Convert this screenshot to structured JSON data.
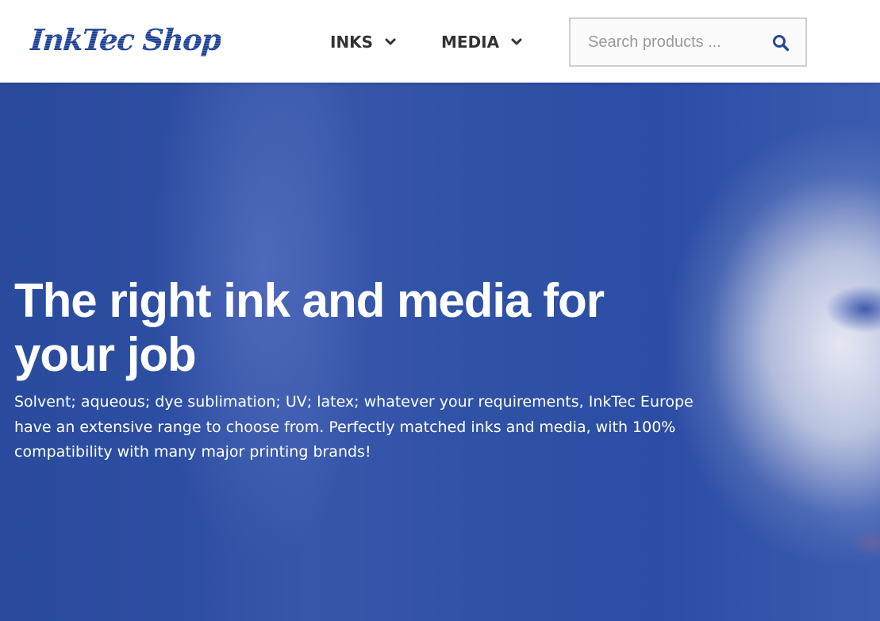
{
  "header": {
    "logo_text": "InkTec Shop",
    "nav": [
      {
        "label": "INKS"
      },
      {
        "label": "MEDIA"
      }
    ],
    "search": {
      "placeholder": "Search products ..."
    }
  },
  "hero": {
    "title": "The right ink and media for your job",
    "text": "Solvent; aqueous; dye sublimation; UV; latex; whatever your requirements, InkTec Europe have an extensive range to choose from. Perfectly matched inks and media, with 100% compatibility with many major printing brands!"
  },
  "colors": {
    "brand_blue": "#23489a",
    "hero_blue": "#2c4ea2",
    "nav_text": "#333333"
  },
  "icons": [
    "chevron-down-icon",
    "search-icon"
  ]
}
